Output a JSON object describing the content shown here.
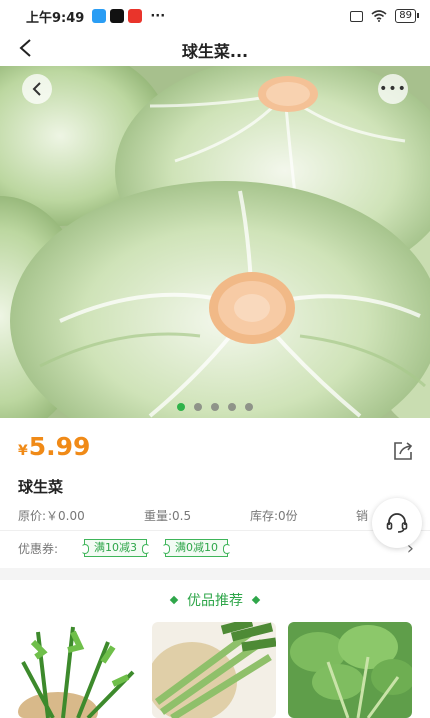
{
  "status_bar": {
    "time": "上午9:49",
    "dots": "···",
    "battery": "89"
  },
  "nav": {
    "back_icon": "chevron-left-icon",
    "title": "球生菜..."
  },
  "hero": {
    "carousel_total": 5,
    "carousel_active": 1
  },
  "product": {
    "currency": "¥",
    "price": "5.99",
    "name": "球生菜",
    "original_price": "原价:￥0.00",
    "weight": "重量:0.5",
    "stock": "库存:0份",
    "sales_partial": "销"
  },
  "coupons": {
    "label": "优惠券:",
    "items": [
      "满10减3",
      "满0减10"
    ]
  },
  "recommend": {
    "title": "优品推荐"
  },
  "colors": {
    "price": "#f08a17",
    "accent_green": "#2fb24a"
  }
}
